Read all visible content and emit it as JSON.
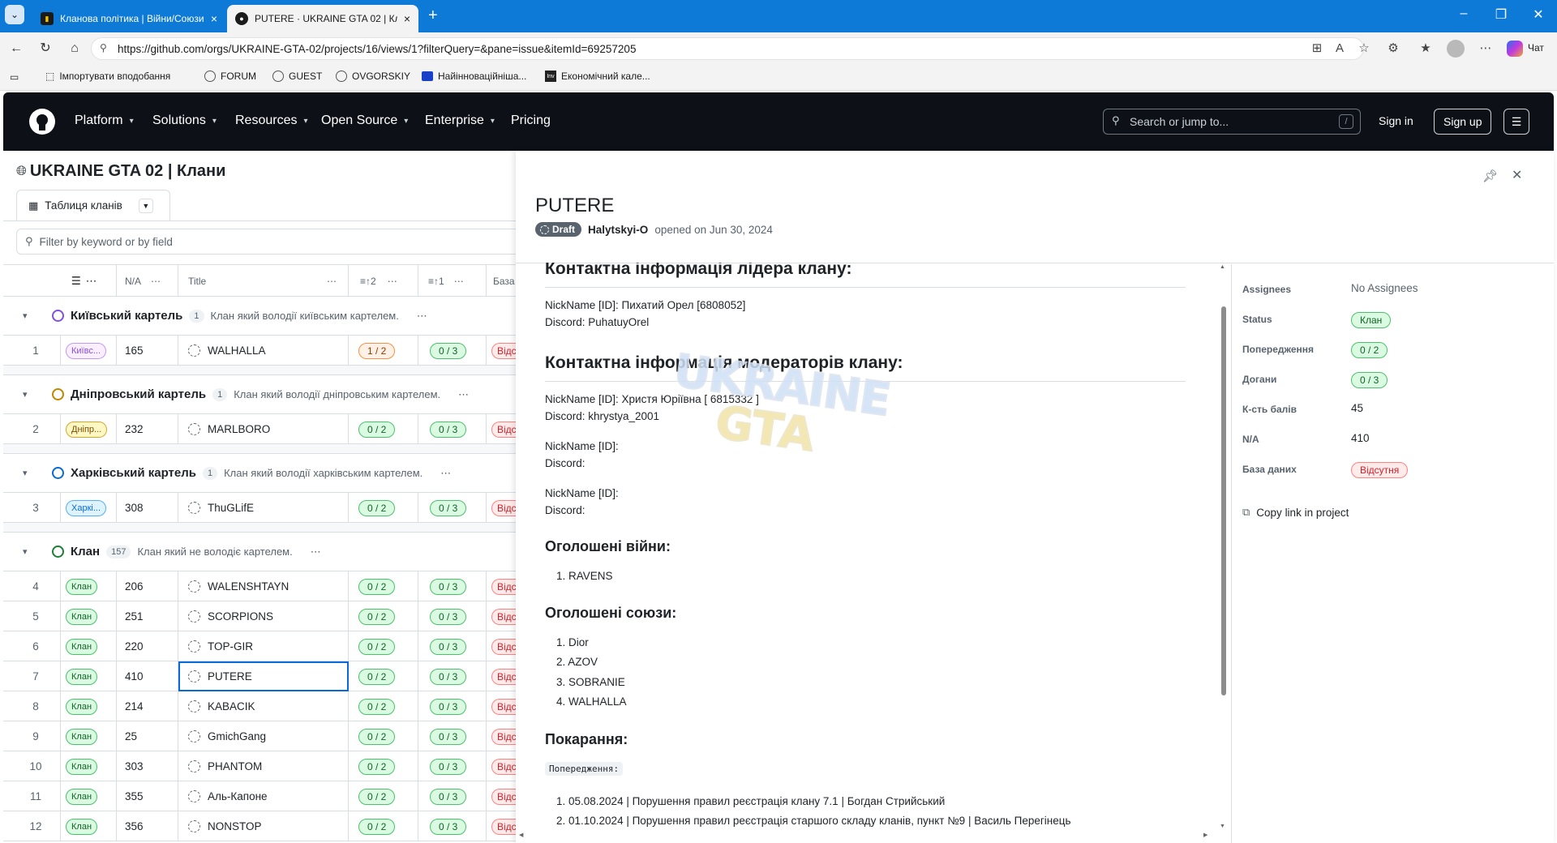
{
  "browser": {
    "tabs": [
      {
        "title": "Кланова політика | Війни/Союзи",
        "active": false
      },
      {
        "title": "PUTERE · UKRAINE GTA 02 | Клани",
        "active": true
      }
    ],
    "url": "https://github.com/orgs/UKRAINE-GTA-02/projects/16/views/1?filterQuery=&pane=issue&itemId=69257205",
    "chat_label": "Чат",
    "bookmarks": [
      "Імпортувати вподобання",
      "FORUM",
      "GUEST",
      "OVGORSKIY",
      "Найінноваційніша...",
      "Економічний кале..."
    ]
  },
  "github": {
    "nav": [
      "Platform",
      "Solutions",
      "Resources",
      "Open Source",
      "Enterprise",
      "Pricing"
    ],
    "search_placeholder": "Search or jump to...",
    "search_key": "/",
    "sign_in": "Sign in",
    "sign_up": "Sign up"
  },
  "project": {
    "title": "UKRAINE GTA 02 | Клани",
    "view_tab": "Таблиця кланів",
    "filter_placeholder": "Filter by keyword or by field",
    "columns": [
      "N/A",
      "Title",
      "2",
      "1",
      "База д"
    ],
    "groups": [
      {
        "name": "Київський картель",
        "count": "1",
        "desc": "Клан який володії київським картелем.",
        "color": "#8250df",
        "rows": [
          {
            "num": "1",
            "tag": "Київс...",
            "tagclass": "purple",
            "na": "165",
            "title": "WALHALLA",
            "warn": "1 / 2",
            "warnclass": "orange",
            "rep": "0 / 3",
            "db": "Відсу"
          }
        ]
      },
      {
        "name": "Дніпровський картель",
        "count": "1",
        "desc": "Клан який володії дніпровським картелем.",
        "color": "#bf8700",
        "rows": [
          {
            "num": "2",
            "tag": "Дніпр...",
            "tagclass": "yellow",
            "na": "232",
            "title": "MARLBORO",
            "warn": "0 / 2",
            "warnclass": "green",
            "rep": "0 / 3",
            "db": "Відсу"
          }
        ]
      },
      {
        "name": "Харківський картель",
        "count": "1",
        "desc": "Клан який володії харківським картелем.",
        "color": "#0969da",
        "rows": [
          {
            "num": "3",
            "tag": "Харкі...",
            "tagclass": "blue",
            "na": "308",
            "title": "ThuGLifE",
            "warn": "0 / 2",
            "warnclass": "green",
            "rep": "0 / 3",
            "db": "Відсу"
          }
        ]
      },
      {
        "name": "Клан",
        "count": "157",
        "desc": "Клан який не володіє картелем.",
        "color": "#1a7f37",
        "rows": [
          {
            "num": "4",
            "tag": "Клан",
            "tagclass": "green",
            "na": "206",
            "title": "WALENSHTAYN",
            "warn": "0 / 2",
            "warnclass": "green",
            "rep": "0 / 3",
            "db": "Відсу"
          },
          {
            "num": "5",
            "tag": "Клан",
            "tagclass": "green",
            "na": "251",
            "title": "SCORPIONS",
            "warn": "0 / 2",
            "warnclass": "green",
            "rep": "0 / 3",
            "db": "Відсу"
          },
          {
            "num": "6",
            "tag": "Клан",
            "tagclass": "green",
            "na": "220",
            "title": "TOP-GIR",
            "warn": "0 / 2",
            "warnclass": "green",
            "rep": "0 / 3",
            "db": "Відсу"
          },
          {
            "num": "7",
            "tag": "Клан",
            "tagclass": "green",
            "na": "410",
            "title": "PUTERE",
            "warn": "0 / 2",
            "warnclass": "green",
            "rep": "0 / 3",
            "db": "Відсу",
            "selected": true
          },
          {
            "num": "8",
            "tag": "Клан",
            "tagclass": "green",
            "na": "214",
            "title": "KABACIK",
            "warn": "0 / 2",
            "warnclass": "green",
            "rep": "0 / 3",
            "db": "Відсу"
          },
          {
            "num": "9",
            "tag": "Клан",
            "tagclass": "green",
            "na": "25",
            "title": "GmichGang",
            "warn": "0 / 2",
            "warnclass": "green",
            "rep": "0 / 3",
            "db": "Відсу"
          },
          {
            "num": "10",
            "tag": "Клан",
            "tagclass": "green",
            "na": "303",
            "title": "PHANTOM",
            "warn": "0 / 2",
            "warnclass": "green",
            "rep": "0 / 3",
            "db": "Відсу"
          },
          {
            "num": "11",
            "tag": "Клан",
            "tagclass": "green",
            "na": "355",
            "title": "Аль-Капоне",
            "warn": "0 / 2",
            "warnclass": "green",
            "rep": "0 / 3",
            "db": "Відсу"
          },
          {
            "num": "12",
            "tag": "Клан",
            "tagclass": "green",
            "na": "356",
            "title": "NONSTOP",
            "warn": "0 / 2",
            "warnclass": "green",
            "rep": "0 / 3",
            "db": "Відсу"
          }
        ]
      }
    ]
  },
  "issue": {
    "title": "PUTERE",
    "draft_label": "Draft",
    "author": "Halytskyi-O",
    "opened_text": "opened on Jun 30, 2024",
    "body": {
      "leader_heading": "Контактна інформація лідера клану:",
      "leader_lines": [
        "NickName [ID]: Пихатий Орел [6808052]",
        "Discord: PuhatuyOrel"
      ],
      "mods_heading": "Контактна інформація модераторів клану:",
      "mod1_lines": [
        "NickName [ID]: Христя Юріївна [ 6815332 ]",
        "Discord: khrystya_2001"
      ],
      "mod2_lines": [
        "NickName [ID]:",
        "Discord:"
      ],
      "mod3_lines": [
        "NickName [ID]:",
        "Discord:"
      ],
      "wars_heading": "Оголошені війни:",
      "wars": [
        "1. RAVENS"
      ],
      "alliances_heading": "Оголошені союзи:",
      "alliances": [
        "1. Dior",
        "2. AZOV",
        "3. SOBRANIE",
        "4. WALHALLA"
      ],
      "punish_heading": "Покарання:",
      "warnings_label": "Попередження:",
      "punish": [
        "1. 05.08.2024 | Порушення правил реєстрація клану 7.1 | Богдан Стрийський",
        "2. 01.10.2024 | Порушення правил реєстрація старшого складу кланів, пункт №9 | Василь Перегінець"
      ]
    },
    "watermark": [
      "UKRAINE",
      "GTA"
    ],
    "meta": [
      {
        "label": "Assignees",
        "value": "No Assignees",
        "kind": "text"
      },
      {
        "label": "Status",
        "value": "Клан",
        "kind": "green"
      },
      {
        "label": "Попередження",
        "value": "0 / 2",
        "kind": "green"
      },
      {
        "label": "Догани",
        "value": "0 / 3",
        "kind": "green"
      },
      {
        "label": "К-сть балів",
        "value": "45",
        "kind": "text"
      },
      {
        "label": "N/A",
        "value": "410",
        "kind": "text"
      },
      {
        "label": "База даних",
        "value": "Відсутня",
        "kind": "red"
      }
    ],
    "copy_link": "Copy link in project"
  }
}
